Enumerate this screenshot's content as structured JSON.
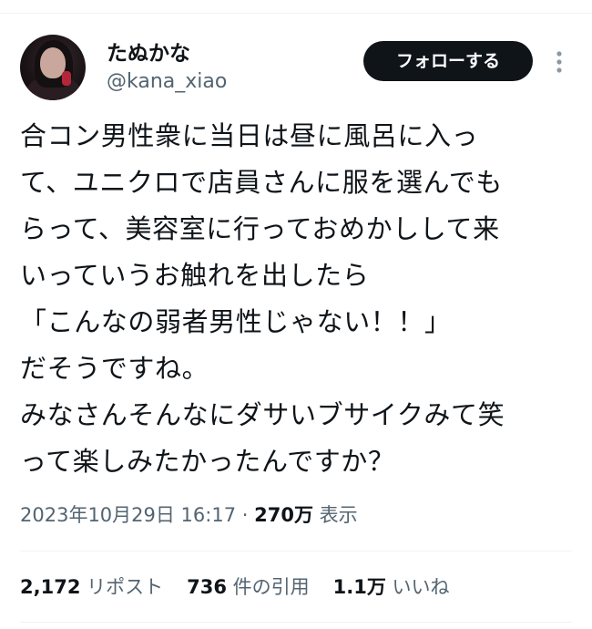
{
  "author": {
    "display_name": "たぬかなㅤ",
    "handle": "@kana_xiao"
  },
  "follow_button_label": "フォローする",
  "tweet": {
    "lines": [
      "合コン男性衆に当日は昼に風呂に入っ",
      "て、ユニクロで店員さんに服を選んでも",
      "らって、美容室に行っておめかしして来",
      "いっていうお触れを出したら",
      "「こんなの弱者男性じゃない！！」",
      "だそうですね。",
      "みなさんそんなにダサいブサイクみて笑",
      "って楽しみたかったんですか？"
    ]
  },
  "meta": {
    "timestamp": "2023年10月29日 16:17",
    "separator": " · ",
    "views_count": "270万",
    "views_label": " 表示"
  },
  "stats": {
    "reposts_count": "2,172",
    "reposts_label": " リポスト",
    "quotes_count": "736",
    "quotes_label": " 件の引用",
    "likes_count": "1.1万",
    "likes_label": " いいね"
  },
  "colors": {
    "text_primary": "#0f1419",
    "text_secondary": "#536471",
    "divider": "#eff3f4",
    "follow_button_bg": "#0f1419"
  },
  "icons": {
    "more": "more-vertical-icon"
  }
}
